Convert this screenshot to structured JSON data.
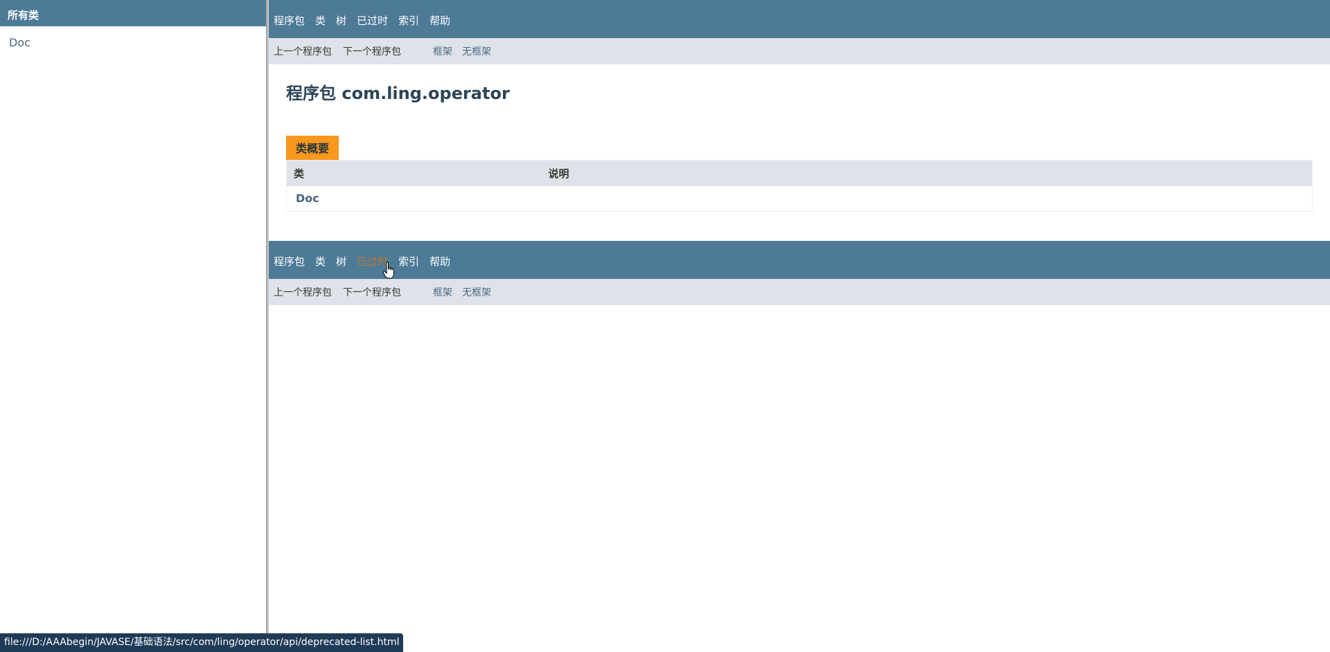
{
  "left_frame": {
    "header": "所有类",
    "classes": [
      "Doc"
    ]
  },
  "top_nav": {
    "items": [
      "程序包",
      "类",
      "树",
      "已过时",
      "索引",
      "帮助"
    ]
  },
  "sub_nav": {
    "prev": "上一个程序包",
    "next": "下一个程序包",
    "frames": "框架",
    "no_frames": "无框架"
  },
  "page": {
    "title": "程序包 com.ling.operator",
    "summary_caption": "类概要",
    "columns": [
      "类",
      "说明"
    ],
    "rows": [
      {
        "class": "Doc",
        "description": ""
      }
    ]
  },
  "status_bar": {
    "url": "file:///D:/AAAbegin/JAVASE/基础语法/src/com/ling/operator/api/deprecated-list.html"
  },
  "colors": {
    "nav_bg": "#4D7A97",
    "subnav_bg": "#dee3e9",
    "caption_bg": "#F8981D",
    "hover_link": "#bb7a2a"
  }
}
